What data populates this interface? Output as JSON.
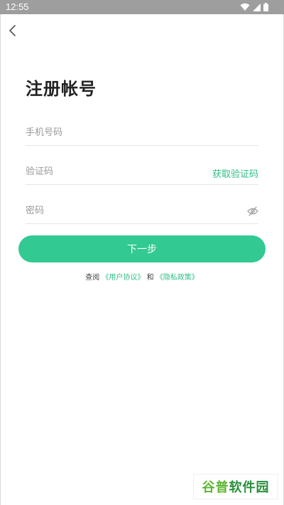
{
  "status_bar": {
    "time": "12:55",
    "icons": [
      "wifi-icon",
      "cell-signal-icon",
      "battery-icon"
    ]
  },
  "nav": {
    "back_icon": "chevron-left-icon"
  },
  "page": {
    "title": "注册帐号"
  },
  "form": {
    "phone": {
      "placeholder": "手机号码",
      "value": ""
    },
    "verification_code": {
      "placeholder": "验证码",
      "value": "",
      "action_label": "获取验证码"
    },
    "password": {
      "placeholder": "密码",
      "value": "",
      "toggle_icon": "eye-off-icon"
    },
    "submit_label": "下一步"
  },
  "agreement": {
    "prefix": "查阅",
    "user_agreement": "《用户协议》",
    "conjunction": "和",
    "privacy_policy": "《隐私政策》"
  },
  "watermark": {
    "part1": "谷普",
    "part2": "软件园"
  },
  "colors": {
    "accent": "#33c992",
    "link": "#2fbf86",
    "status_bar": "#9e9e9e",
    "title": "#222222",
    "placeholder": "#9a9a9a"
  }
}
